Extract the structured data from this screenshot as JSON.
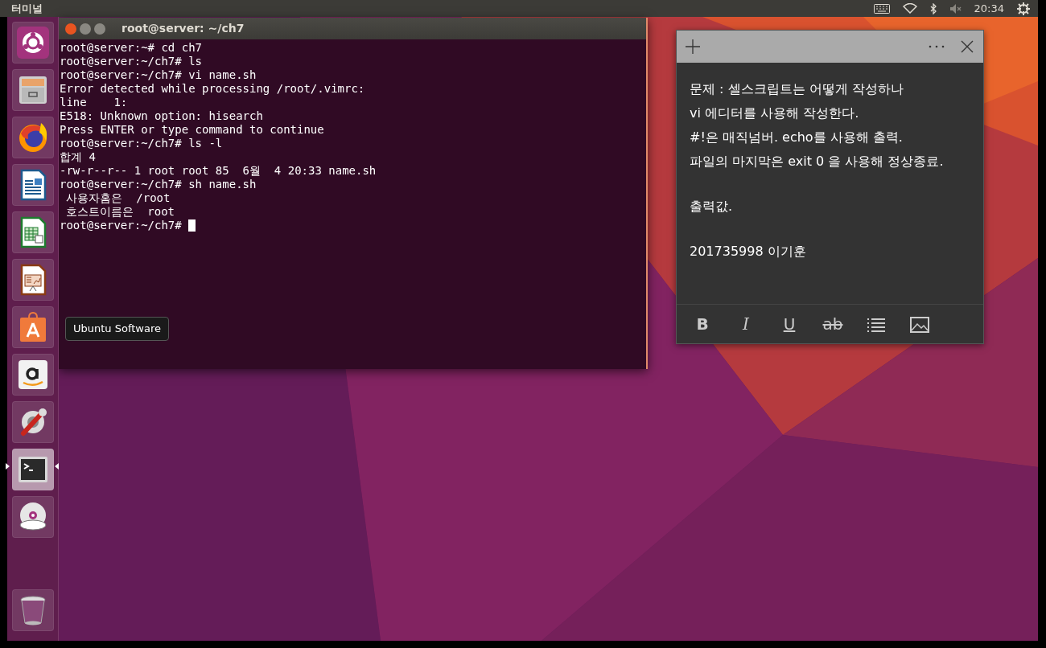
{
  "top_bar": {
    "title": "터미널",
    "volume_muted": true,
    "clock": "20:34"
  },
  "launcher": [
    {
      "kind": "dash",
      "selected": false
    },
    {
      "kind": "files",
      "selected": false
    },
    {
      "kind": "browser",
      "selected": false
    },
    {
      "kind": "writer",
      "selected": false
    },
    {
      "kind": "calc",
      "selected": false
    },
    {
      "kind": "impress",
      "selected": false
    },
    {
      "kind": "software",
      "selected": false
    },
    {
      "kind": "amazon",
      "selected": false
    },
    {
      "kind": "settings",
      "selected": false
    },
    {
      "kind": "terminal",
      "selected": true
    },
    {
      "kind": "dvd",
      "selected": false
    },
    {
      "kind": "trash",
      "selected": false
    }
  ],
  "tooltip": {
    "text": "Ubuntu Software"
  },
  "terminal": {
    "title": "root@server: ~/ch7",
    "cursor": true,
    "lines": [
      "root@server:~# cd ch7",
      "root@server:~/ch7# ls",
      "root@server:~/ch7# vi name.sh",
      "Error detected while processing /root/.vimrc:",
      "line    1:",
      "E518: Unknown option: hisearch",
      "Press ENTER or type command to continue",
      "root@server:~/ch7# ls -l",
      "합계 4",
      "-rw-r--r-- 1 root root 85  6월  4 20:33 name.sh",
      "root@server:~/ch7# sh name.sh",
      " 사용자홈은  /root",
      " 호스트이름은  root",
      "root@server:~/ch7# "
    ]
  },
  "sticky_note": {
    "paragraphs": [
      [
        "문제 : 셀스크립트는 어떻게 작성하나",
        "vi 에디터를 사용해 작성한다.",
        "#!은 매직넘버. echo를 사용해 출력.",
        "파일의 마지막은 exit 0 을 사용해 정상종료."
      ],
      [
        "출력값."
      ],
      [
        "201735998 이기훈"
      ]
    ],
    "toolbar": [
      {
        "kind": "bold",
        "label": "B"
      },
      {
        "kind": "italic",
        "label": "I"
      },
      {
        "kind": "underline",
        "label": "U"
      },
      {
        "kind": "strike",
        "label": "ab"
      },
      {
        "kind": "list"
      },
      {
        "kind": "image"
      }
    ]
  }
}
